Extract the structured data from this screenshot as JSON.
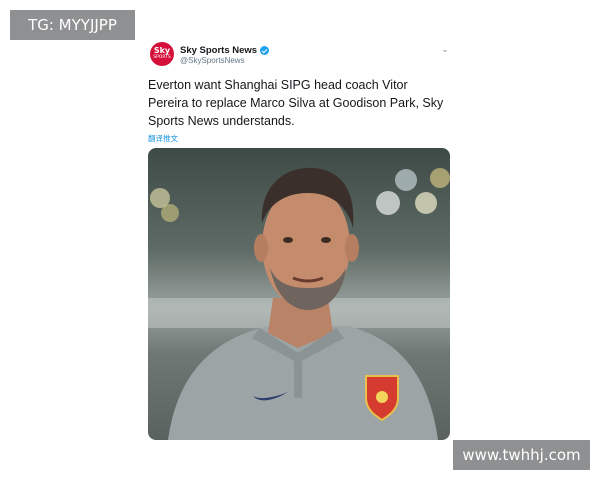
{
  "watermarks": {
    "top": "TG: MYYJJPP",
    "bottom": "www.twhhj.com"
  },
  "tweet": {
    "avatar_line1": "Sky",
    "avatar_line2": "SPORTS",
    "display_name": "Sky Sports News",
    "handle": "@SkySportsNews",
    "text": "Everton want Shanghai SIPG head coach Vitor Pereira to replace Marco Silva at Goodison Park, Sky Sports News understands.",
    "translate_label": "翻译推文",
    "photo_icon": "man-portrait-photo"
  },
  "colors": {
    "watermark_bg": "#8f9091",
    "brand_red": "#d40f3a",
    "link_blue": "#1b95e0",
    "verified_blue": "#1da1f2"
  }
}
